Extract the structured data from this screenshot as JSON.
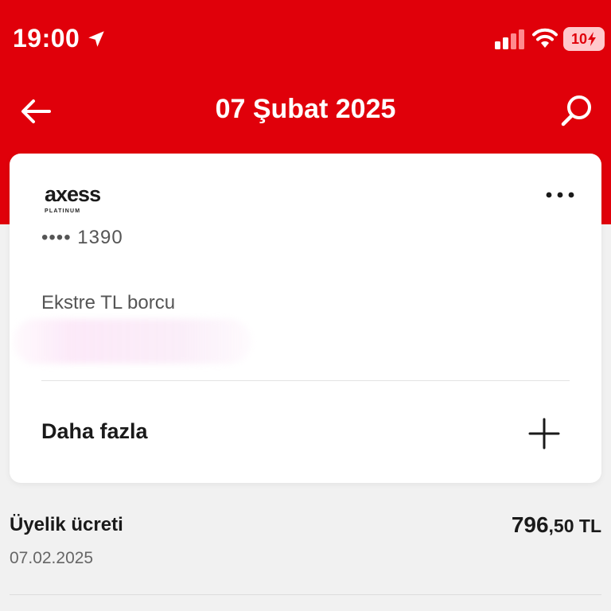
{
  "theme": {
    "brand_red": "#e0000a",
    "background": "#f1f1f1",
    "card": "#ffffff"
  },
  "status_bar": {
    "time": "19:00",
    "location_icon": "location-arrow-icon",
    "signal_icon": "cellular-signal-icon",
    "wifi_icon": "wifi-icon",
    "battery_level": "10",
    "battery_icon": "battery-charging-icon"
  },
  "header": {
    "title": "07 Şubat 2025",
    "back_icon": "arrow-left-icon",
    "search_icon": "search-icon"
  },
  "card": {
    "brand_name": "axess",
    "brand_tier": "PLATINUM",
    "masked_number": "•••• 1390",
    "debt_label": "Ekstre TL borcu",
    "more_icon": "more-horizontal-icon",
    "expand_label": "Daha fazla",
    "expand_icon": "plus-icon"
  },
  "transactions": [
    {
      "title": "Üyelik ücreti",
      "date": "07.02.2025",
      "amount_integer": "796",
      "amount_decimal": ",50 TL"
    }
  ]
}
